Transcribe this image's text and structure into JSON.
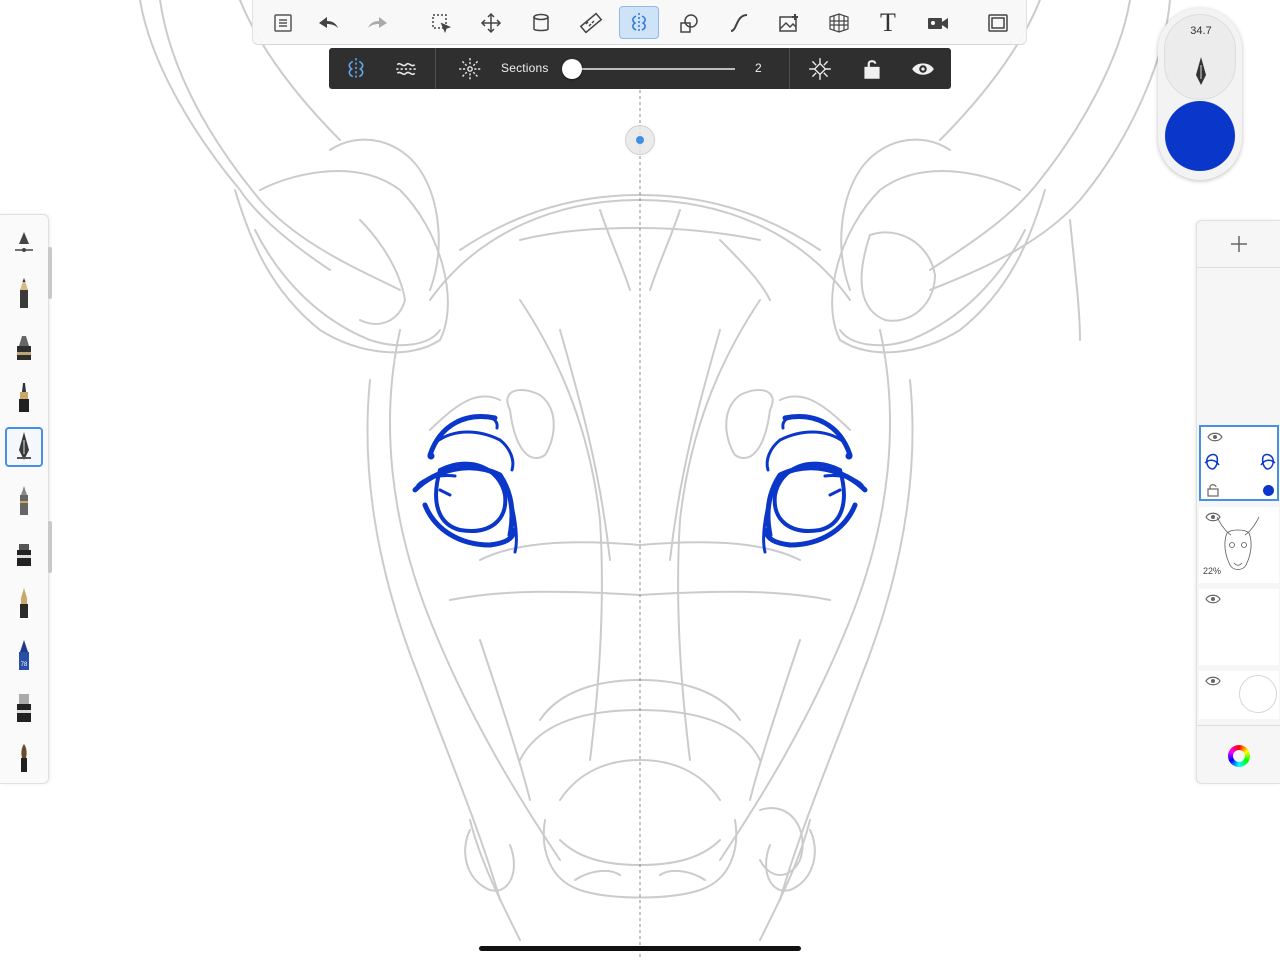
{
  "top_toolbar": {
    "tools": [
      {
        "name": "gallery",
        "icon": "list-icon"
      },
      {
        "name": "undo",
        "icon": "undo-arrow-icon"
      },
      {
        "name": "redo",
        "icon": "redo-arrow-icon"
      },
      {
        "name": "selection",
        "icon": "selection-icon"
      },
      {
        "name": "transform",
        "icon": "move-icon"
      },
      {
        "name": "fill",
        "icon": "fill-bucket-icon"
      },
      {
        "name": "ruler",
        "icon": "ruler-icon"
      },
      {
        "name": "symmetry",
        "icon": "symmetry-icon",
        "active": true
      },
      {
        "name": "shapes",
        "icon": "shapes-icon"
      },
      {
        "name": "curve",
        "icon": "curve-icon"
      },
      {
        "name": "image-import",
        "icon": "image-add-icon"
      },
      {
        "name": "perspective",
        "icon": "perspective-grid-icon"
      },
      {
        "name": "text",
        "icon": "text-icon",
        "label": "T"
      },
      {
        "name": "time-lapse",
        "icon": "video-camera-icon"
      },
      {
        "name": "fullscreen",
        "icon": "fullscreen-icon"
      }
    ]
  },
  "symmetry_toolbar": {
    "sections_label": "Sections",
    "sections_value": "2",
    "slider_fraction": 0.0,
    "modes": [
      "vertical-symmetry-icon",
      "wave-symmetry-icon",
      "radial-symmetry-icon"
    ],
    "actions": [
      "center-target-icon",
      "unlock-icon",
      "eye-icon"
    ]
  },
  "brush_puck": {
    "size": "34.7",
    "color": "#0a36c9"
  },
  "brush_palette": {
    "brushes": [
      {
        "name": "smudge",
        "icon": "smudge-icon"
      },
      {
        "name": "pencil",
        "icon": "pencil-icon"
      },
      {
        "name": "marker",
        "icon": "marker-icon"
      },
      {
        "name": "ink-pen",
        "icon": "ink-pen-icon"
      },
      {
        "name": "technical-pen",
        "icon": "technical-pen-icon",
        "active": true
      },
      {
        "name": "ballpoint",
        "icon": "ballpoint-icon"
      },
      {
        "name": "chisel-marker",
        "icon": "chisel-marker-icon"
      },
      {
        "name": "fountain-pen",
        "icon": "fountain-pen-icon"
      },
      {
        "name": "color-pencil",
        "icon": "color-pencil-icon",
        "badge": "78"
      },
      {
        "name": "eraser",
        "icon": "eraser-icon"
      },
      {
        "name": "paint-brush",
        "icon": "paint-brush-icon"
      }
    ]
  },
  "layers": {
    "add_label": "+",
    "items": [
      {
        "name": "eyes-layer",
        "selected": true,
        "visible": true
      },
      {
        "name": "sketch-layer",
        "opacity": "22%",
        "visible": true
      },
      {
        "name": "empty-layer",
        "visible": true
      },
      {
        "name": "background-layer",
        "visible": true
      }
    ],
    "accent": "#4a90e2"
  }
}
